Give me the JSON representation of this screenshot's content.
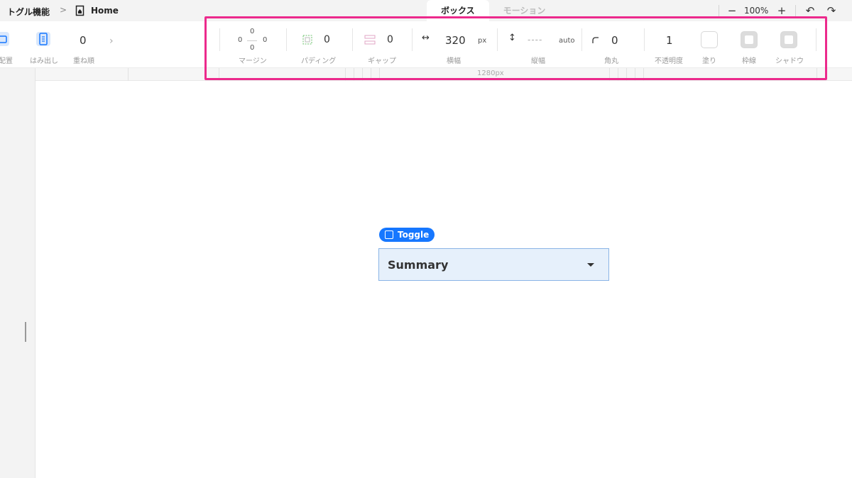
{
  "breadcrumb": {
    "project": "トグル機能",
    "separator": ">",
    "page": "Home"
  },
  "tabs": [
    {
      "label": "ボックス",
      "active": true
    },
    {
      "label": "モーション",
      "active": false
    }
  ],
  "zoom": {
    "value": "100%",
    "minus": "−",
    "plus": "+"
  },
  "history": {
    "undo": "↶",
    "redo": "↷"
  },
  "props": {
    "placement": {
      "label": "配置"
    },
    "overflow": {
      "label": "はみ出し"
    },
    "zorder": {
      "label": "重ね順",
      "value": "0"
    },
    "more": "›",
    "margin": {
      "label": "マージン",
      "top": "0",
      "left": "0",
      "right": "0",
      "bottom": "0"
    },
    "padding": {
      "label": "パディング",
      "value": "0"
    },
    "gap": {
      "label": "ギャップ",
      "value": "0"
    },
    "width": {
      "label": "横幅",
      "value": "320",
      "unit": "px",
      "icon": "↔"
    },
    "height": {
      "label": "縦幅",
      "value": "----",
      "unit": "auto",
      "icon": "↕"
    },
    "radius": {
      "label": "角丸",
      "value": "0"
    },
    "opacity": {
      "label": "不透明度",
      "value": "1"
    },
    "fill": {
      "label": "塗り"
    },
    "border": {
      "label": "枠線"
    },
    "shadow": {
      "label": "シャドウ"
    }
  },
  "ruler": {
    "label": "1280px"
  },
  "canvas": {
    "tag_label": "Toggle",
    "toggle_text": "Summary"
  },
  "colors": {
    "highlight": "#ec2a8c",
    "accent": "#1677ff",
    "toggle_bg": "#e6f0fb"
  }
}
